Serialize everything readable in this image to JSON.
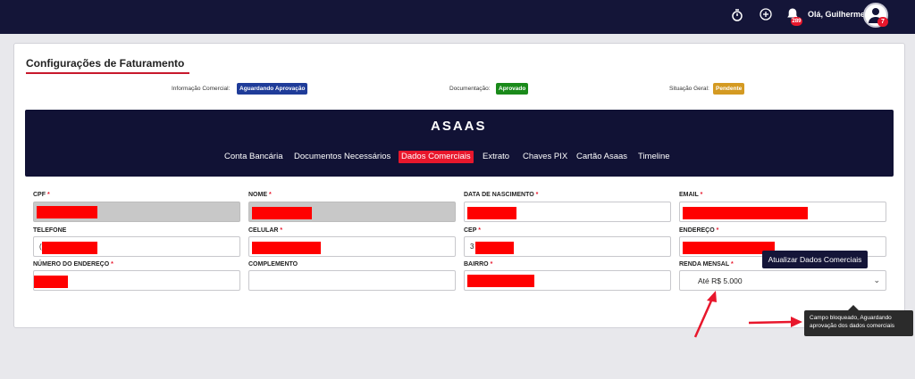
{
  "header": {
    "greeting": "Olá, Guilherme",
    "notification_count": "289",
    "avatar_badge": "7",
    "icons": [
      "timer-icon",
      "add-circle-icon",
      "bell-icon",
      "user-avatar-icon"
    ]
  },
  "page": {
    "title": "Configurações de Faturamento"
  },
  "status": {
    "commercial_label": "Informação Comercial:",
    "commercial_value": "Aguardando Aprovação",
    "documentation_label": "Documentação:",
    "documentation_value": "Aprovado",
    "general_label": "Situação Geral:",
    "general_value": "Pendente",
    "colors": {
      "waiting": "#1f3c99",
      "approved": "#1a8a1a",
      "pending": "#d49a22"
    }
  },
  "banner": {
    "logo": "ASAAS",
    "tabs": [
      {
        "label": "Conta Bancária"
      },
      {
        "label": "Documentos Necessários"
      },
      {
        "label": "Dados Comerciais",
        "active": true
      },
      {
        "label": "Extrato"
      },
      {
        "label": "Chaves PIX"
      },
      {
        "label": "Cartão Asaas"
      },
      {
        "label": "Timeline"
      }
    ]
  },
  "form": {
    "cpf_label": "CPF",
    "nome_label": "NOME",
    "nascimento_label": "DATA DE NASCIMENTO",
    "email_label": "EMAIL",
    "telefone_label": "TELEFONE",
    "telefone_prefix": "(",
    "celular_label": "CELULAR",
    "cep_label": "CEP",
    "cep_prefix": "3",
    "endereco_label": "ENDEREÇO",
    "numero_label": "NÚMERO DO ENDEREÇO",
    "complemento_label": "COMPLEMENTO",
    "bairro_label": "BAIRRO",
    "renda_label": "RENDA MENSAL",
    "renda_value": "Até R$ 5.000",
    "required_mark": "*"
  },
  "actions": {
    "update_label": "Atualizar Dados Comerciais",
    "tooltip": "Campo bloqueado, Aguardando aprovação dos dados comerciais"
  },
  "colors": {
    "topbar": "#141538",
    "accent": "#e8172c",
    "redaction": "#ff0000"
  }
}
